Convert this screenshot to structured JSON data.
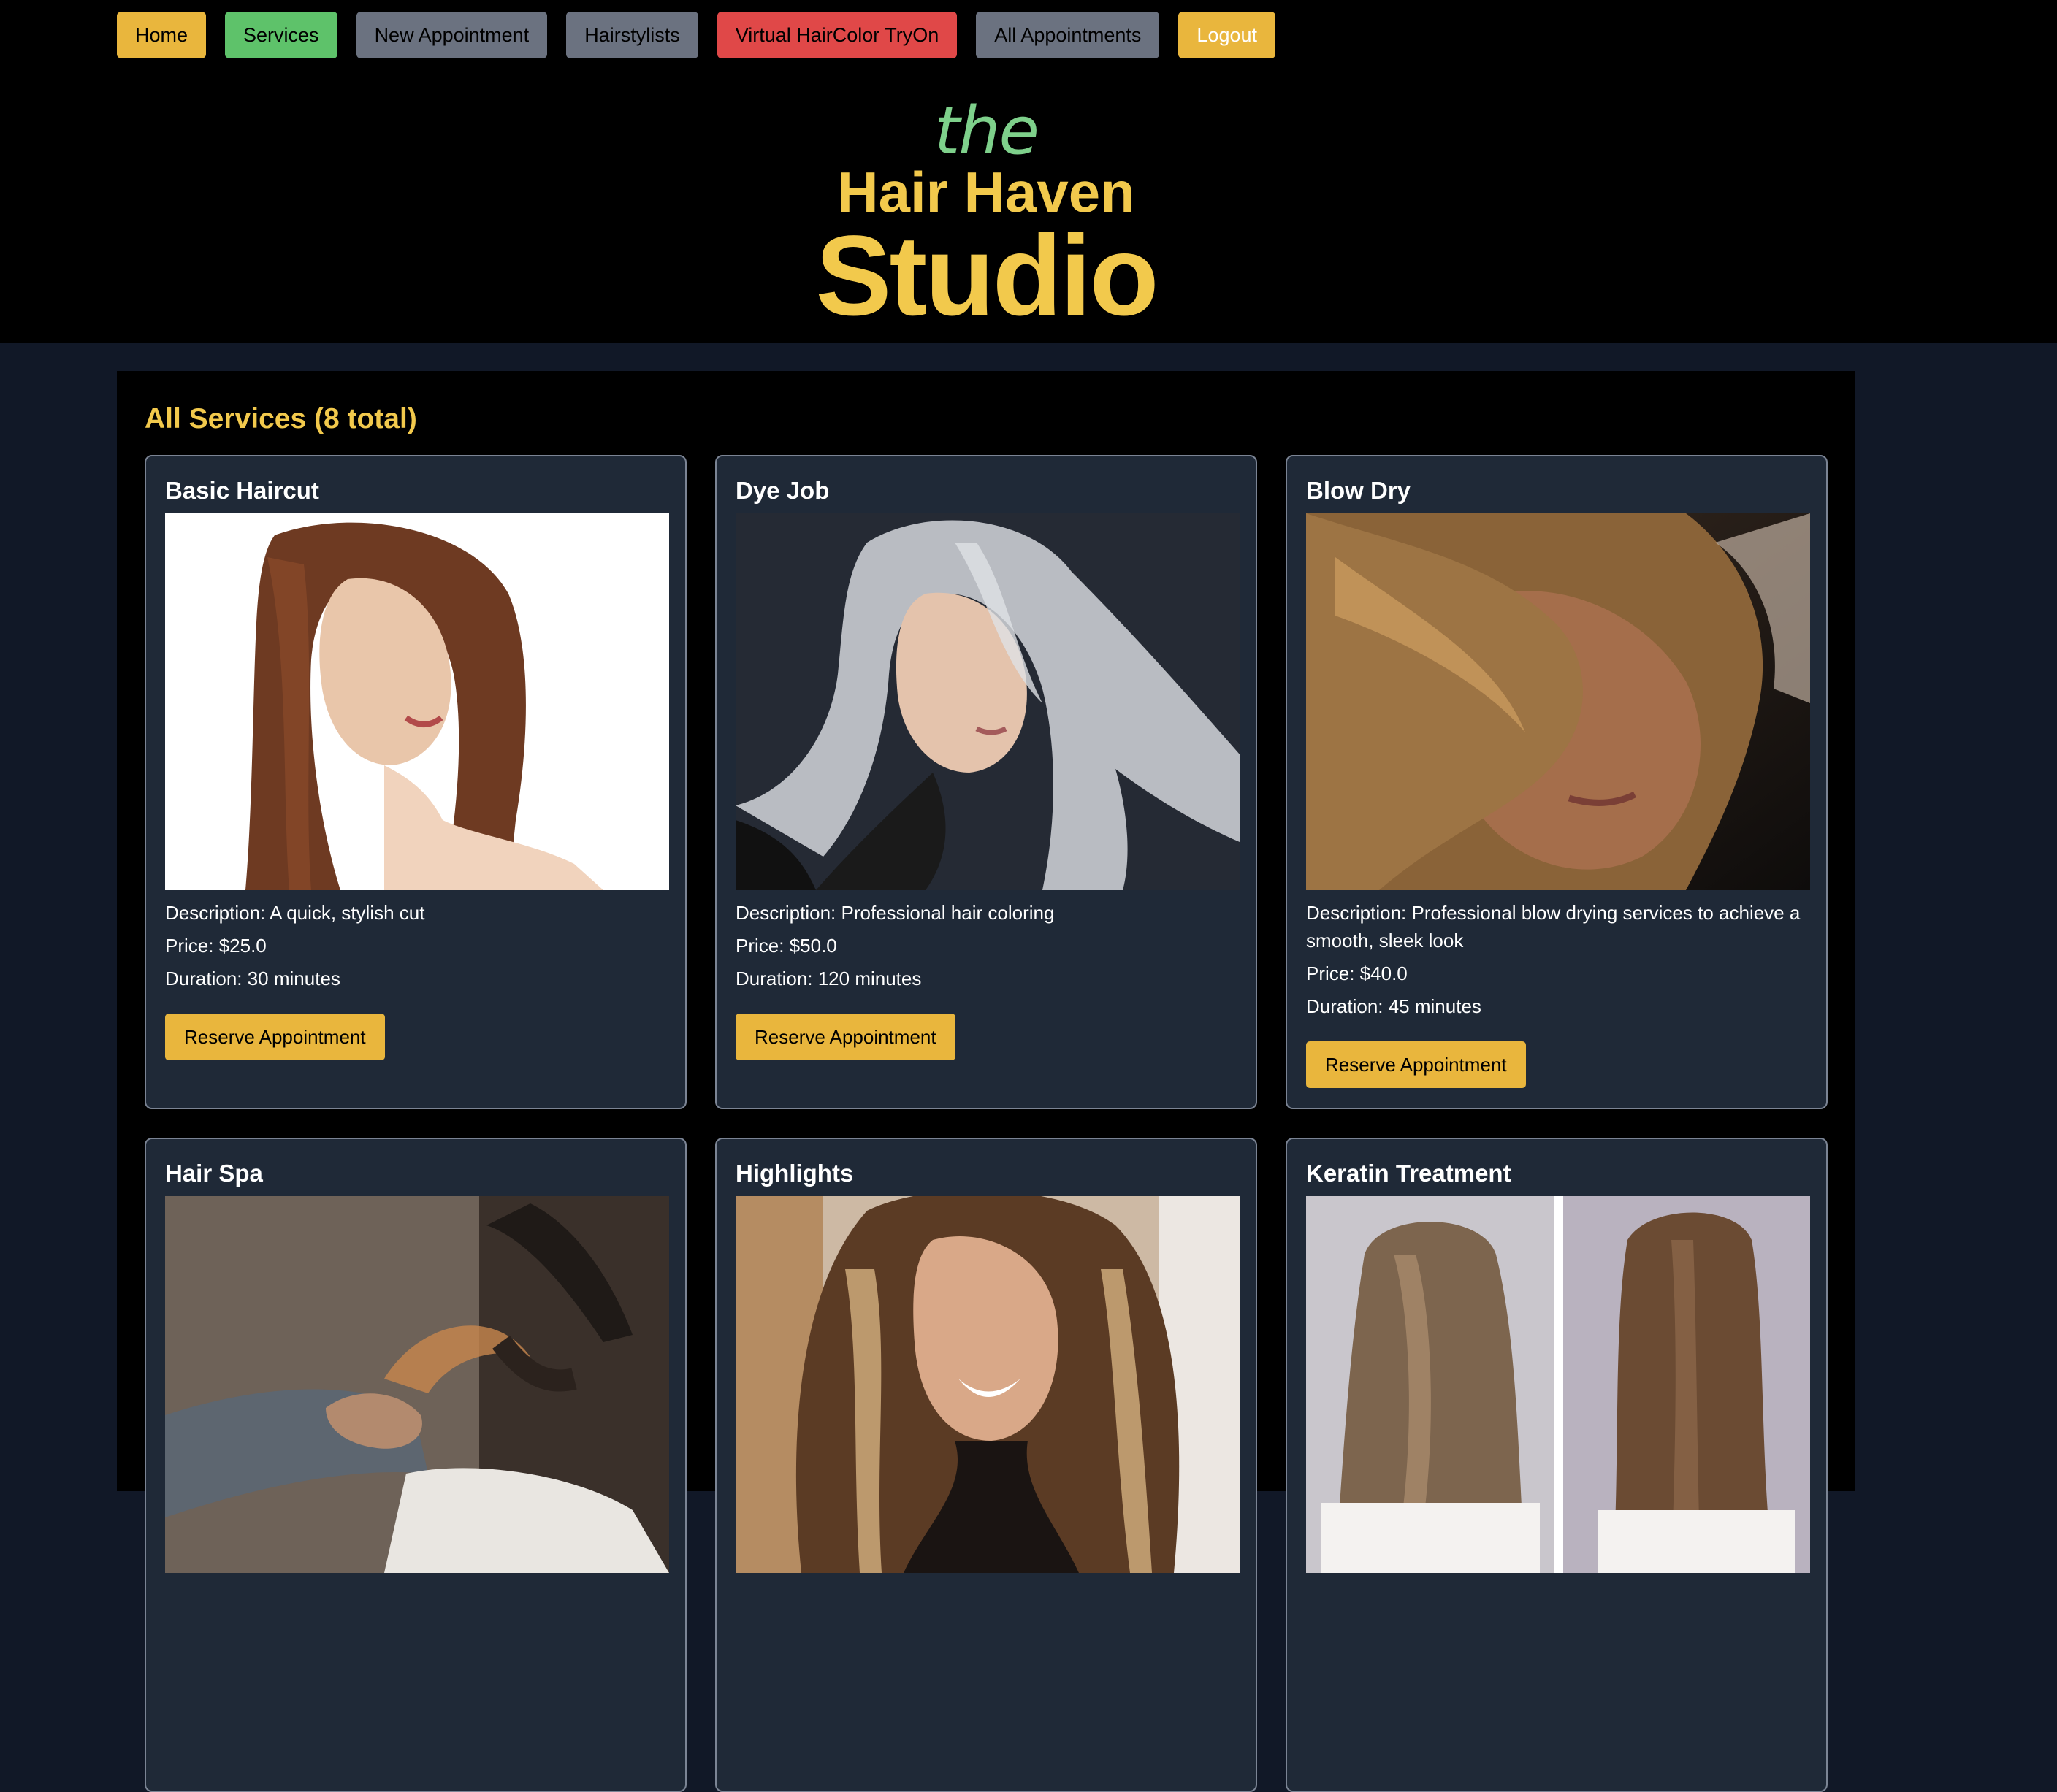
{
  "nav": {
    "items": [
      {
        "label": "Home"
      },
      {
        "label": "Services"
      },
      {
        "label": "New Appointment"
      },
      {
        "label": "Hairstylists"
      },
      {
        "label": "Virtual HairColor TryOn"
      },
      {
        "label": "All Appointments"
      },
      {
        "label": "Logout"
      }
    ]
  },
  "brand": {
    "line1": "the",
    "line2": "Hair Haven",
    "line3": "Studio"
  },
  "section": {
    "title": "All Services (8 total)"
  },
  "services": [
    {
      "name": "Basic Haircut",
      "description": "Description: A quick, stylish cut",
      "price": "Price: $25.0",
      "duration": "Duration: 30 minutes",
      "button": "Reserve Appointment"
    },
    {
      "name": "Dye Job",
      "description": "Description: Professional hair coloring",
      "price": "Price: $50.0",
      "duration": "Duration: 120 minutes",
      "button": "Reserve Appointment"
    },
    {
      "name": "Blow Dry",
      "description": "Description: Professional blow drying services to achieve a smooth, sleek look",
      "price": "Price: $40.0",
      "duration": "Duration: 45 minutes",
      "button": "Reserve Appointment"
    },
    {
      "name": "Hair Spa"
    },
    {
      "name": "Highlights"
    },
    {
      "name": "Keratin Treatment"
    }
  ],
  "colors": {
    "accent_yellow": "#f2c94c",
    "button_yellow": "#e9b63d",
    "green": "#5ec26a",
    "gray": "#6b7280",
    "red": "#e04848",
    "card_bg": "#1f2937",
    "page_bg": "#111827"
  }
}
